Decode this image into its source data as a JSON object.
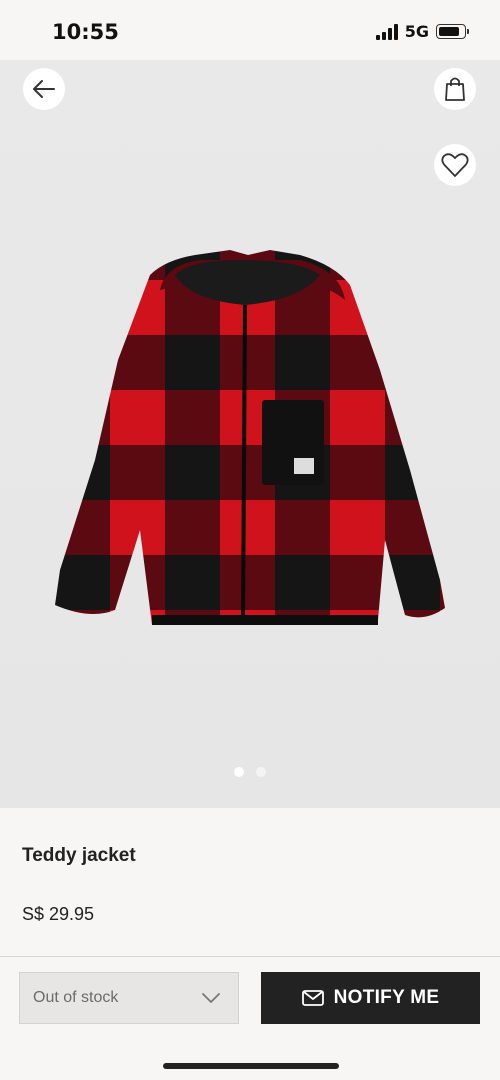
{
  "status_bar": {
    "time": "10:55",
    "network": "5G",
    "battery_level": 0.85
  },
  "icons": {
    "back": "arrow-left-icon",
    "bag": "shopping-bag-icon",
    "favorite": "heart-icon",
    "dropdown": "chevron-down-icon",
    "mail": "envelope-icon"
  },
  "gallery": {
    "image_count": 2,
    "active_index": 0
  },
  "product": {
    "title": "Teddy jacket",
    "price": "S$ 29.95"
  },
  "actions": {
    "size_select_value": "Out of stock",
    "notify_label": "NOTIFY ME"
  },
  "colors": {
    "accent": "#222222",
    "jacket_red": "#d0121c",
    "jacket_black": "#151515"
  }
}
